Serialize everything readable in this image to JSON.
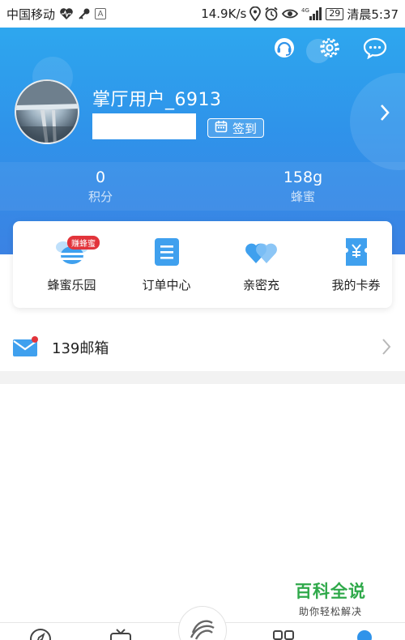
{
  "status_bar": {
    "carrier": "中国移动",
    "net_speed": "14.9K/s",
    "signal_label": "4G",
    "battery": "29",
    "time": "清晨5:37",
    "a_badge": "A"
  },
  "header": {
    "icons": [
      "service-headset-icon",
      "settings-gear-icon",
      "message-bubble-icon"
    ],
    "username": "掌厅用户_6913",
    "signin_label": "签到"
  },
  "stats": [
    {
      "value": "0",
      "label": "积分"
    },
    {
      "value": "158g",
      "label": "蜂蜜"
    }
  ],
  "quick_actions": [
    {
      "label": "蜂蜜乐园",
      "icon": "bee-icon",
      "badge": "赚蜂蜜"
    },
    {
      "label": "订单中心",
      "icon": "order-doc-icon"
    },
    {
      "label": "亲密充",
      "icon": "double-heart-icon"
    },
    {
      "label": "我的卡券",
      "icon": "coupon-icon"
    }
  ],
  "mail": {
    "label": "139邮箱"
  },
  "watermark": {
    "title": "百科全说",
    "subtitle": "助你轻松解决"
  },
  "colors": {
    "header_top": "#2ea7ee",
    "header_bottom": "#3b82e3",
    "icon_blue": "#3fa0ee",
    "badge_red": "#e2343b",
    "watermark_green": "#2fa94a"
  }
}
